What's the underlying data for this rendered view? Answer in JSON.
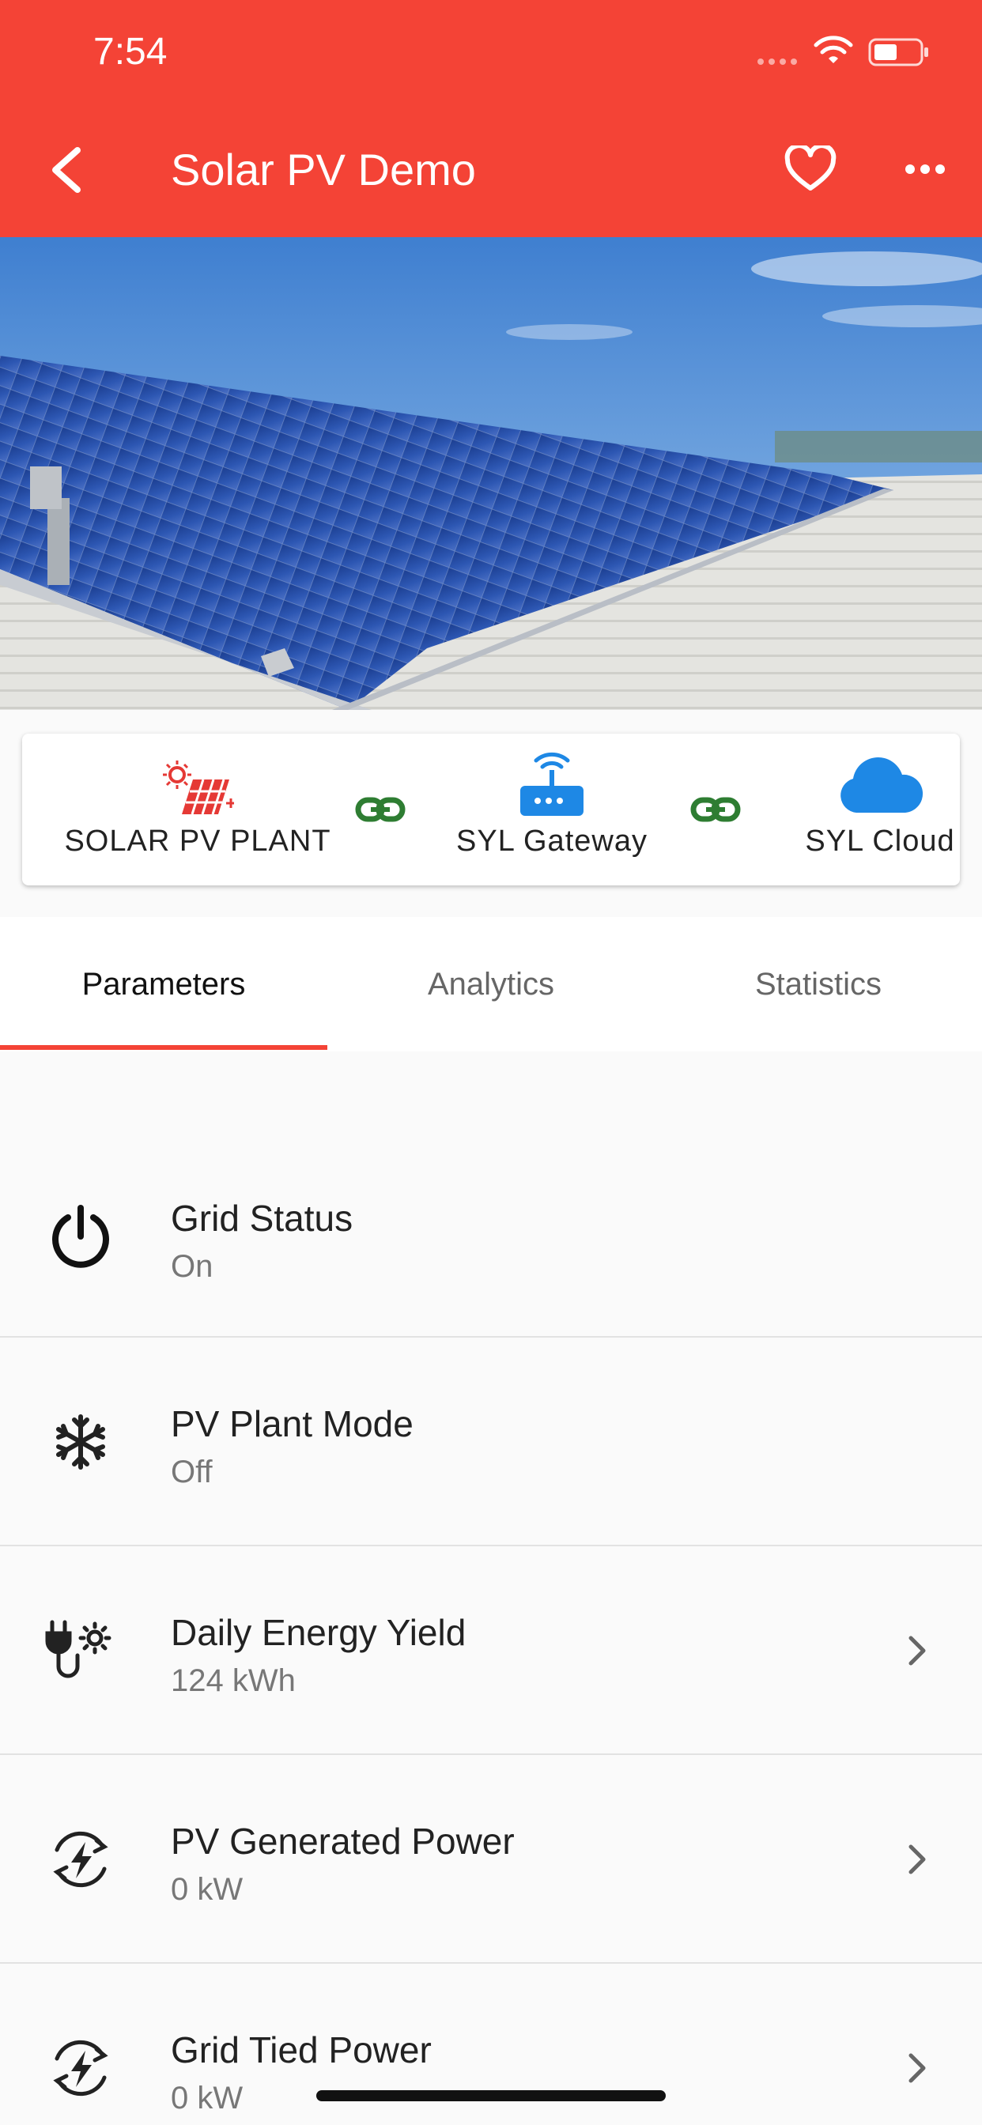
{
  "status_bar": {
    "time": "7:54"
  },
  "app_bar": {
    "title": "Solar PV Demo"
  },
  "connection": {
    "nodes": [
      {
        "label": "SOLAR PV PLANT",
        "icon": "solar-panel-icon",
        "color": "#e53935"
      },
      {
        "label": "SYL Gateway",
        "icon": "router-icon",
        "color": "#1e88e5"
      },
      {
        "label": "SYL Cloud",
        "icon": "cloud-icon",
        "color": "#1e88e5"
      }
    ],
    "link_icon": "link-icon",
    "link_color": "#2e7d32"
  },
  "tabs": [
    {
      "label": "Parameters",
      "active": true
    },
    {
      "label": "Analytics",
      "active": false
    },
    {
      "label": "Statistics",
      "active": false
    }
  ],
  "parameters": [
    {
      "title": "Grid Status",
      "value": "On",
      "icon": "power-icon",
      "has_chevron": false
    },
    {
      "title": "PV Plant Mode",
      "value": "Off",
      "icon": "snowflake-icon",
      "has_chevron": false
    },
    {
      "title": "Daily Energy Yield",
      "value": "124 kWh",
      "icon": "plug-sun-icon",
      "has_chevron": true
    },
    {
      "title": "PV Generated Power",
      "value": "0 kW",
      "icon": "energy-cycle-icon",
      "has_chevron": true
    },
    {
      "title": "Grid Tied Power",
      "value": "0 kW",
      "icon": "energy-cycle-icon",
      "has_chevron": true
    }
  ],
  "colors": {
    "primary": "#f44336",
    "accent_blue": "#1e88e5",
    "link_green": "#2e7d32"
  }
}
